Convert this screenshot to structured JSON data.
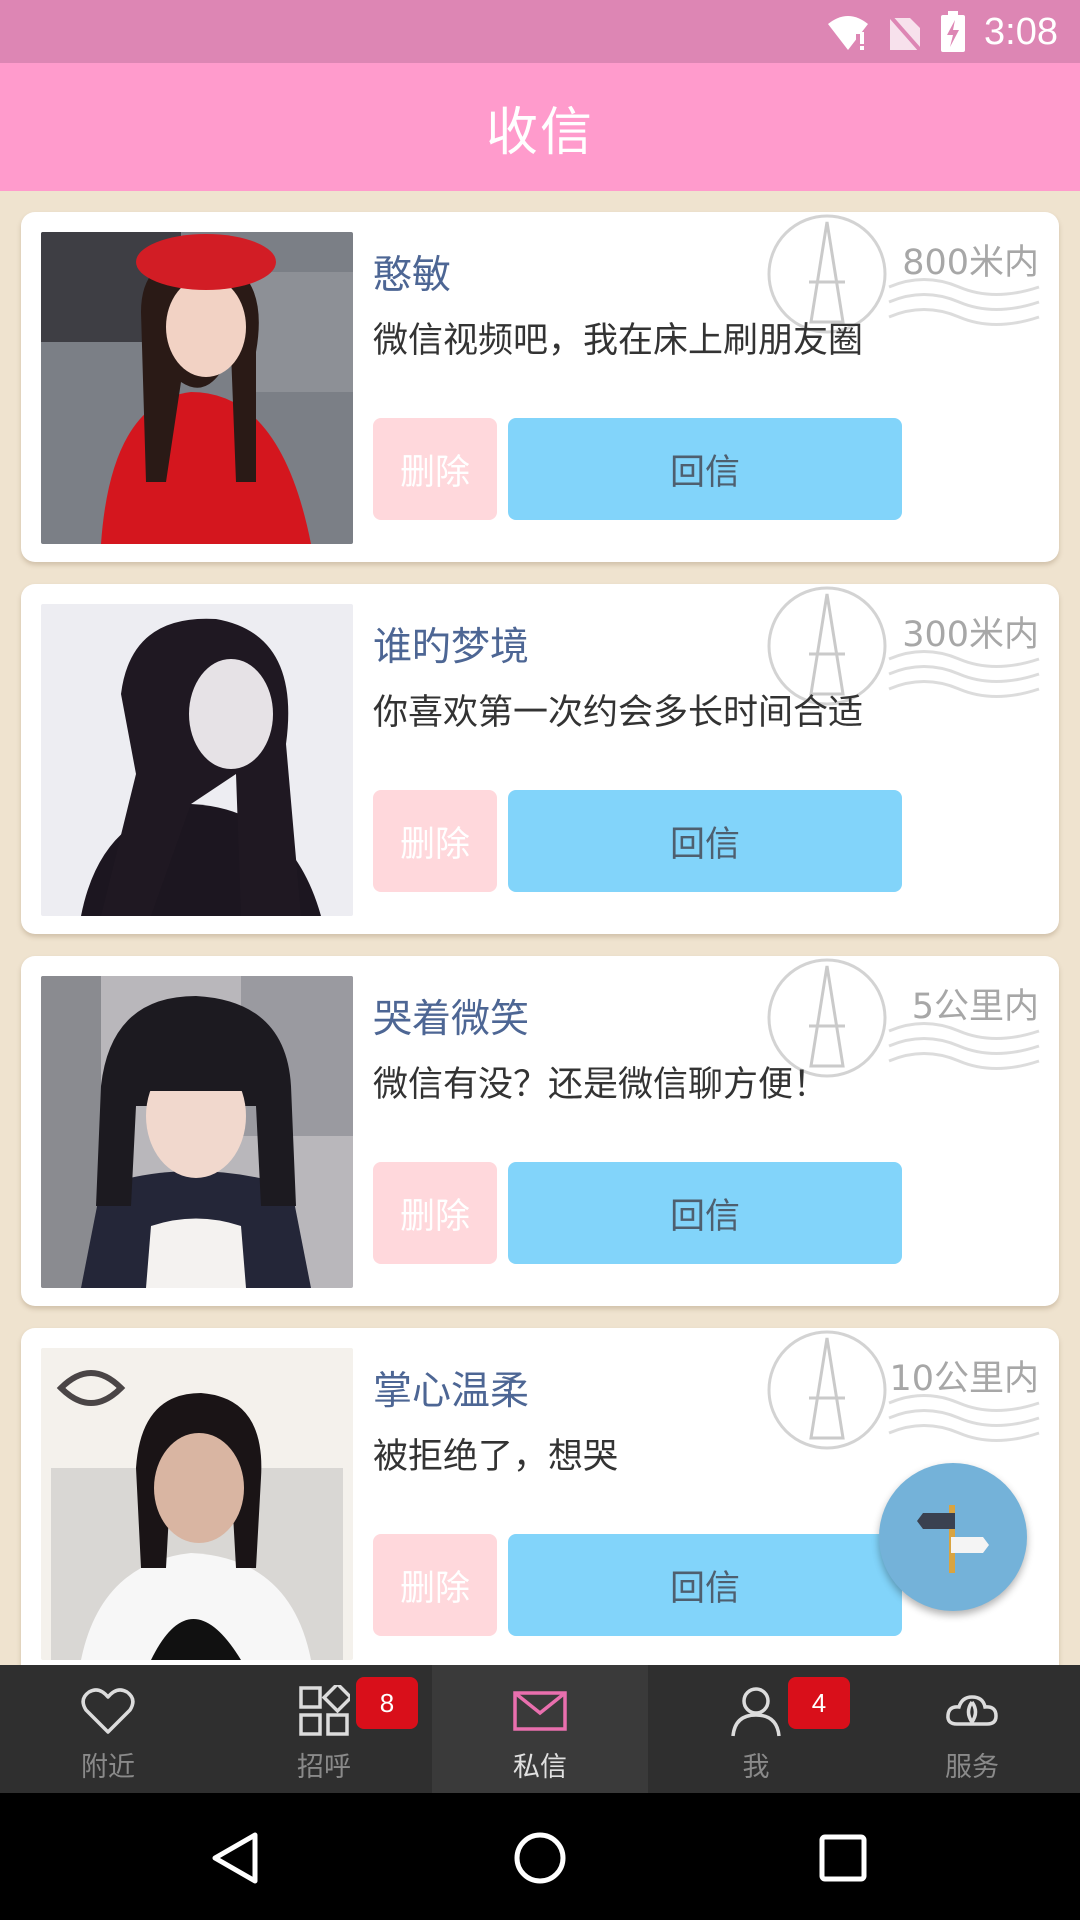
{
  "status_bar": {
    "time": "3:08"
  },
  "app_bar": {
    "title": "收信"
  },
  "messages": [
    {
      "name": "憨敏",
      "text": "微信视频吧，我在床上刷朋友圈",
      "distance": "800米内",
      "delete_label": "删除",
      "reply_label": "回信"
    },
    {
      "name": "谁旳梦境",
      "text": "你喜欢第一次约会多长时间合适",
      "distance": "300米内",
      "delete_label": "删除",
      "reply_label": "回信"
    },
    {
      "name": "哭着微笑",
      "text": "微信有没？还是微信聊方便！",
      "distance": "5公里内",
      "delete_label": "删除",
      "reply_label": "回信"
    },
    {
      "name": "掌心温柔",
      "text": "被拒绝了，想哭",
      "distance": "10公里内",
      "delete_label": "删除",
      "reply_label": "回信"
    }
  ],
  "bottom_nav": [
    {
      "label": "附近",
      "icon": "heart-icon"
    },
    {
      "label": "招呼",
      "icon": "grid-icon",
      "badge": "8"
    },
    {
      "label": "私信",
      "icon": "envelope-icon"
    },
    {
      "label": "我",
      "icon": "person-icon",
      "badge": "4"
    },
    {
      "label": "服务",
      "icon": "cloud-icon"
    }
  ],
  "colors": {
    "status_bar": "#dd86b4",
    "app_bar": "#ff9bcc",
    "background": "#efe3cf",
    "reply_button": "#82d4fa",
    "delete_button": "#ffd8dc",
    "name_text": "#4d6694",
    "fab": "#74b2d9",
    "nav_active": "#e96fae",
    "badge": "#d90f1a"
  }
}
